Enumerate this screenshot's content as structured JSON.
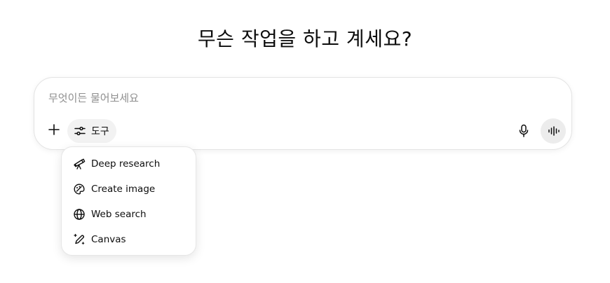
{
  "headline": "무슨 작업을 하고 계세요?",
  "composer": {
    "placeholder": "무엇이든 물어보세요",
    "value": "",
    "tools_label": "도구"
  },
  "tools_menu": {
    "items": [
      {
        "label": "Deep research",
        "icon": "telescope-icon"
      },
      {
        "label": "Create image",
        "icon": "palette-icon"
      },
      {
        "label": "Web search",
        "icon": "globe-icon"
      },
      {
        "label": "Canvas",
        "icon": "pen-sparkle-icon"
      }
    ]
  },
  "icons": {
    "add": "plus-icon",
    "tools": "sliders-icon",
    "mic": "microphone-icon",
    "voice": "voice-waveform-icon"
  }
}
